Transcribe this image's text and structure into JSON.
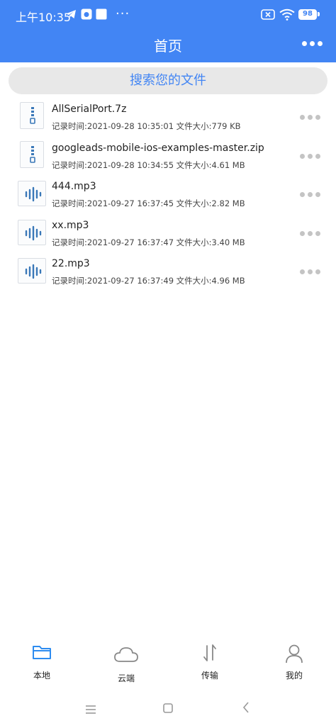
{
  "status_bar": {
    "time": "上午10:35",
    "dots": "···",
    "battery": "98"
  },
  "header": {
    "title": "首页"
  },
  "search": {
    "placeholder": "搜索您的文件"
  },
  "files": [
    {
      "name": "AllSerialPort.7z",
      "meta": "记录时间:2021-09-28 10:35:01 文件大小:779 KB",
      "icon": "archive-file-icon"
    },
    {
      "name": "googleads-mobile-ios-examples-master.zip",
      "meta": "记录时间:2021-09-28 10:34:55 文件大小:4.61 MB",
      "icon": "archive-file-icon"
    },
    {
      "name": "444.mp3",
      "meta": "记录时间:2021-09-27 16:37:45 文件大小:2.82 MB",
      "icon": "audio-file-icon"
    },
    {
      "name": "xx.mp3",
      "meta": "记录时间:2021-09-27 16:37:47 文件大小:3.40 MB",
      "icon": "audio-file-icon"
    },
    {
      "name": "22.mp3",
      "meta": "记录时间:2021-09-27 16:37:49 文件大小:4.96 MB",
      "icon": "audio-file-icon"
    }
  ],
  "tabs": [
    {
      "label": "本地",
      "icon": "folder-icon",
      "active": true
    },
    {
      "label": "云端",
      "icon": "cloud-icon",
      "active": false
    },
    {
      "label": "传输",
      "icon": "transfer-arrows-icon",
      "active": false
    },
    {
      "label": "我的",
      "icon": "user-icon",
      "active": false
    }
  ],
  "colors": {
    "accent": "#4285f4",
    "icon_blue": "#3a78b8",
    "tab_active_icon": "#2d8cf0",
    "tab_inactive_icon": "#888888"
  }
}
